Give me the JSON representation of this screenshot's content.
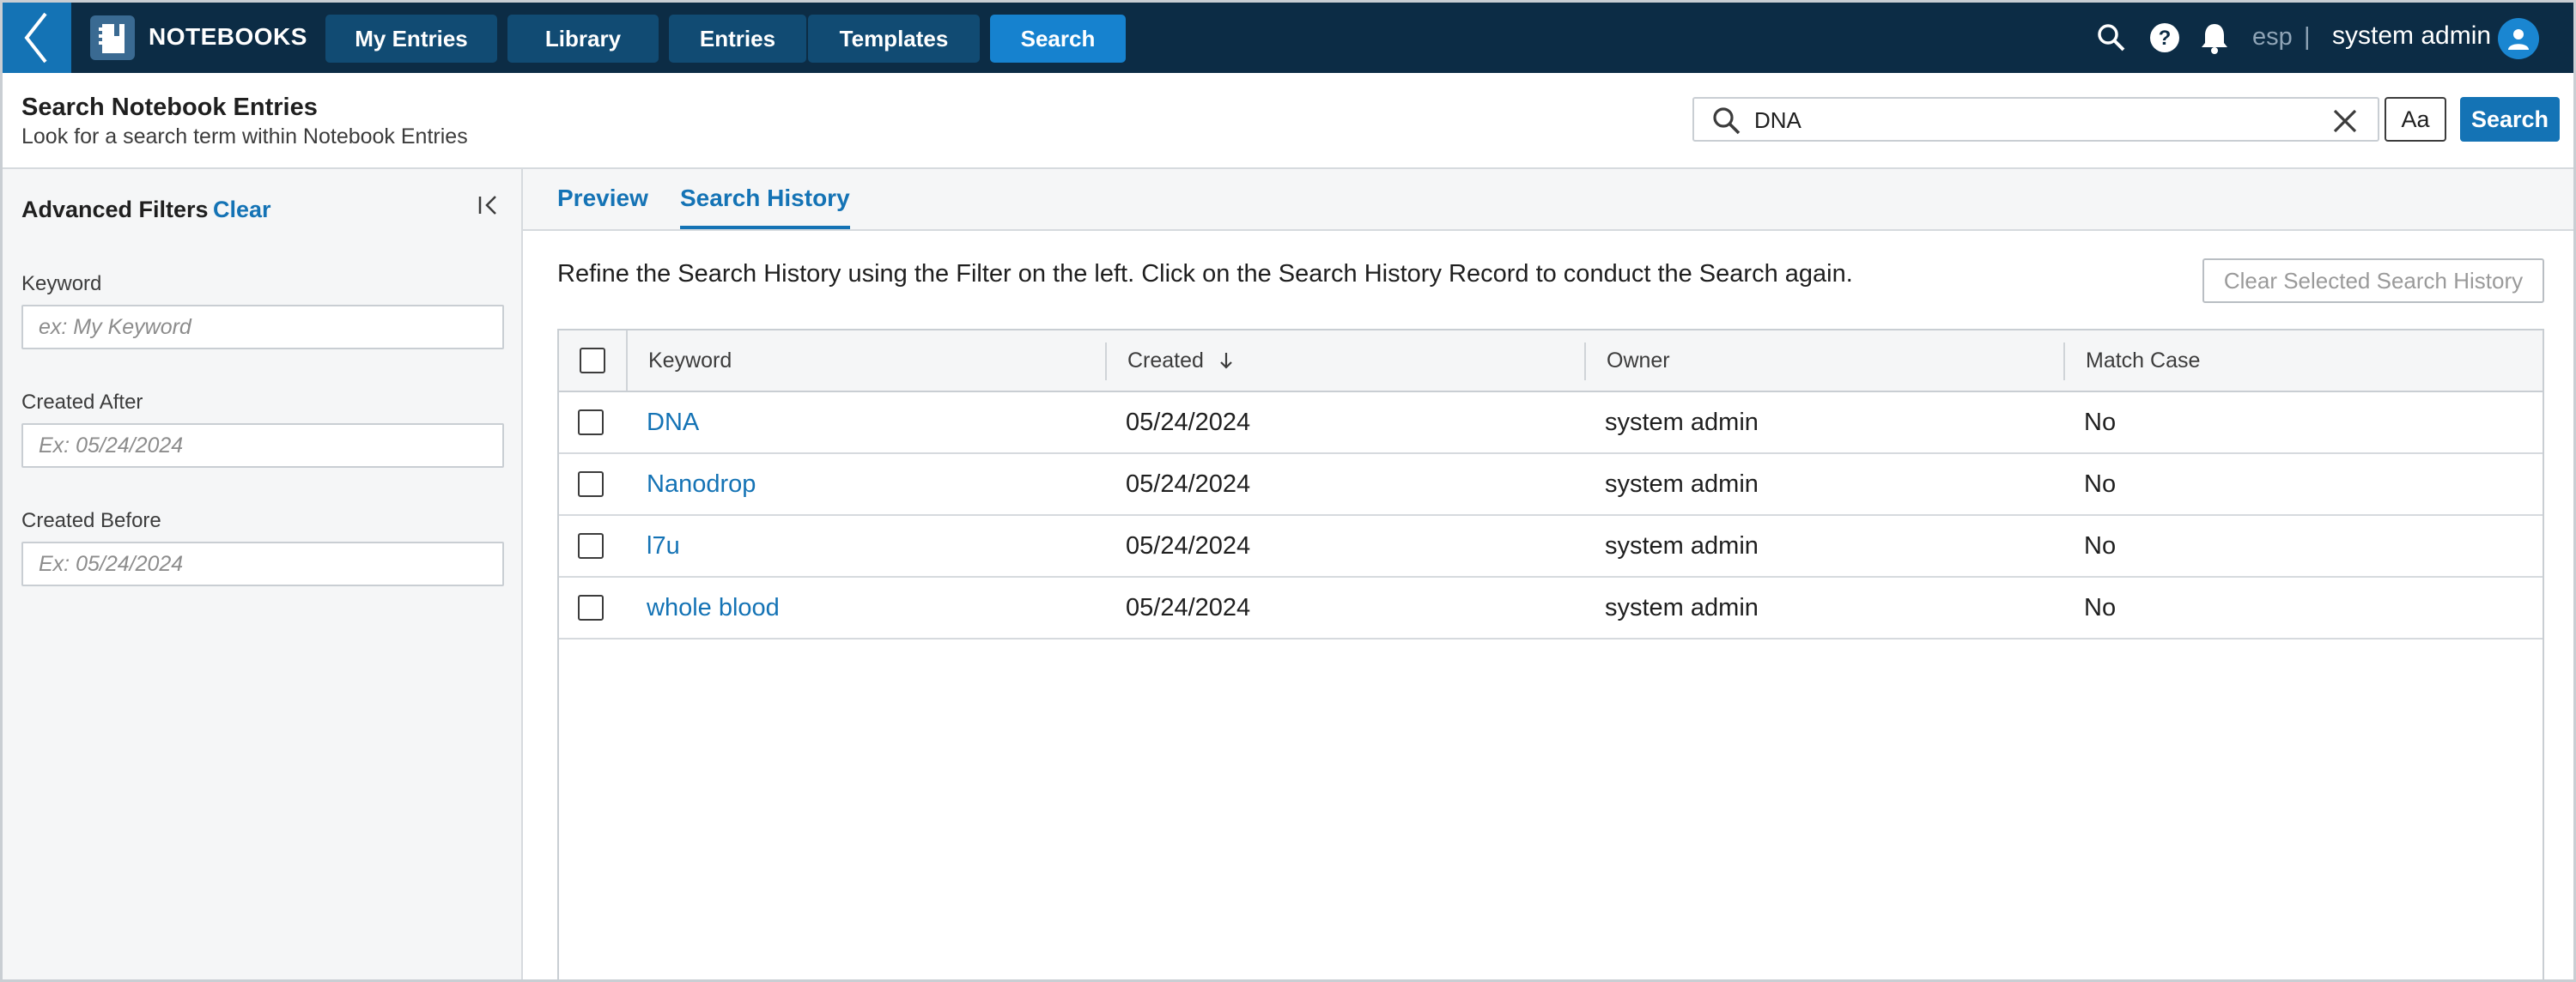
{
  "app": {
    "title": "NOTEBOOKS",
    "nav_tabs": [
      {
        "label": "My Entries",
        "active": false
      },
      {
        "label": "Library",
        "active": false
      },
      {
        "label": "Entries",
        "active": false
      },
      {
        "label": "Templates",
        "active": false
      },
      {
        "label": "Search",
        "active": true
      }
    ],
    "language": "esp",
    "language_separator": "|",
    "user_name": "system admin"
  },
  "header": {
    "title": "Search Notebook Entries",
    "subtitle": "Look for a search term within Notebook Entries",
    "search_value": "DNA",
    "match_case_label": "Aa",
    "search_button_label": "Search"
  },
  "filters": {
    "title": "Advanced Filters",
    "clear_label": "Clear",
    "keyword_label": "Keyword",
    "keyword_placeholder": "ex: My Keyword",
    "created_after_label": "Created After",
    "created_after_placeholder": "Ex: 05/24/2024",
    "created_before_label": "Created Before",
    "created_before_placeholder": "Ex: 05/24/2024"
  },
  "tabs": [
    {
      "label": "Preview",
      "active": false
    },
    {
      "label": "Search History",
      "active": true
    }
  ],
  "history": {
    "instructions": "Refine the Search History using the Filter on the left. Click on the Search History Record to conduct the Search again.",
    "clear_selected_label": "Clear Selected Search History",
    "columns": {
      "keyword": "Keyword",
      "created": "Created",
      "owner": "Owner",
      "match_case": "Match Case"
    },
    "rows": [
      {
        "keyword": "DNA",
        "created": "05/24/2024",
        "owner": "system admin",
        "match_case": "No"
      },
      {
        "keyword": "Nanodrop",
        "created": "05/24/2024",
        "owner": "system admin",
        "match_case": "No"
      },
      {
        "keyword": "l7u",
        "created": "05/24/2024",
        "owner": "system admin",
        "match_case": "No"
      },
      {
        "keyword": "whole blood",
        "created": "05/24/2024",
        "owner": "system admin",
        "match_case": "No"
      }
    ]
  },
  "colors": {
    "topbar": "#0c2c45",
    "accent": "#1473b5",
    "active_tab": "#1682cf"
  }
}
